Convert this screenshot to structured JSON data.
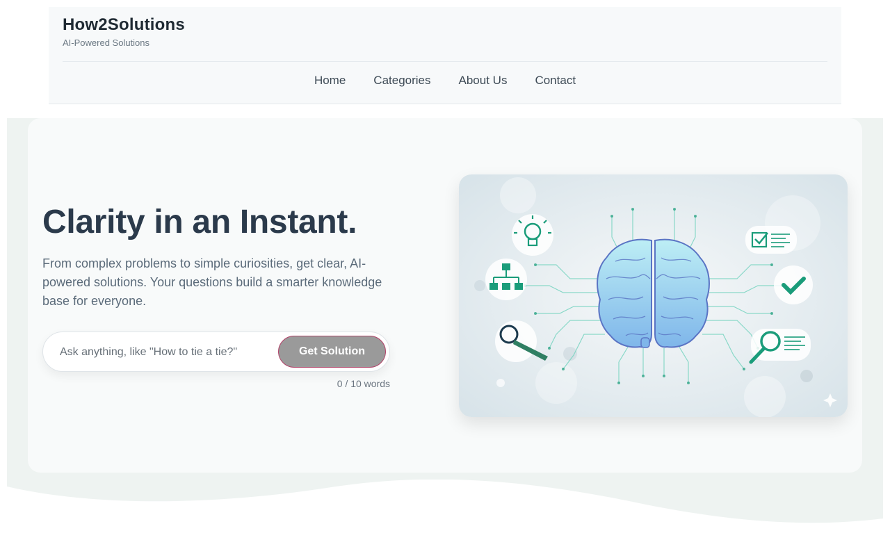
{
  "header": {
    "brand_title": "How2Solutions",
    "brand_tagline": "AI-Powered Solutions",
    "nav": [
      {
        "label": "Home"
      },
      {
        "label": "Categories"
      },
      {
        "label": "About Us"
      },
      {
        "label": "Contact"
      }
    ]
  },
  "hero": {
    "title": "Clarity in an Instant.",
    "subtitle": "From complex problems to simple curiosities, get clear, AI-powered solutions. Your questions build a smarter knowledge base for everyone.",
    "search": {
      "placeholder": "Ask anything, like \"How to tie a tie?\"",
      "value": "",
      "button_label": "Get Solution"
    },
    "word_count": "0 / 10 words",
    "illustration": {
      "icons": [
        "brain-icon",
        "lightbulb-icon",
        "org-chart-icon",
        "magnifier-tie-icon",
        "checklist-icon",
        "checkmark-icon",
        "search-document-icon",
        "sparkle-icon"
      ]
    }
  },
  "colors": {
    "accent_green": "#1a9c7a",
    "title_navy": "#2b3a4b",
    "button_grey": "#9a9a9a",
    "button_border": "#b2456b"
  }
}
